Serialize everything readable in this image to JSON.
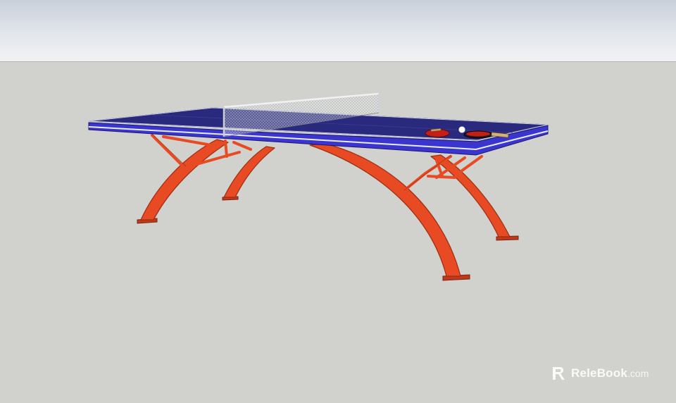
{
  "colors": {
    "sky_top": "#c9cfd9",
    "ground": "#d1d1cd",
    "table_top": "#29297e",
    "table_edge": "#3b35d0",
    "frame": "#e84a24",
    "frame_dark": "#b43514",
    "net": "#9aa0a8",
    "paddle": "#c51e14",
    "ball": "#ffffff"
  },
  "scene": {
    "objects": [
      "table-tennis-table",
      "net",
      "paddle",
      "paddle",
      "ball"
    ]
  },
  "watermark": {
    "icon": "relebook-logo-icon",
    "brand": "ReleBook",
    "tld": ".com"
  }
}
